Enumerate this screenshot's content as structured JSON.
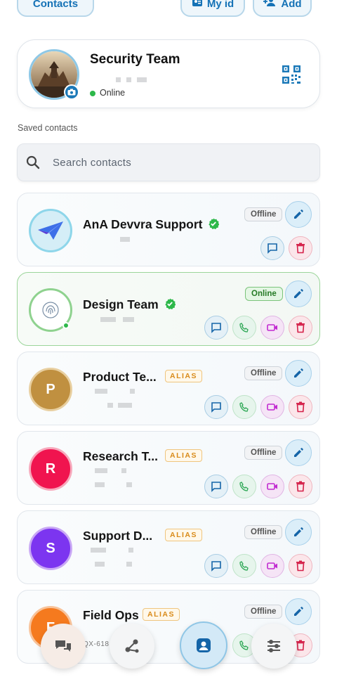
{
  "header": {
    "contacts_label": "Contacts",
    "my_id_label": "My id",
    "add_label": "Add"
  },
  "profile": {
    "name": "Security Team",
    "status": "Online",
    "qr_icon": "qr-code-icon",
    "camera_icon": "camera-icon"
  },
  "saved_label": "Saved contacts",
  "search": {
    "placeholder": "Search contacts"
  },
  "contacts": [
    {
      "name": "AnA Devvra Support",
      "verified": true,
      "status": "Offline",
      "avatar": "paper-plane-logo"
    },
    {
      "name": "Design Team",
      "verified": true,
      "status": "Online",
      "avatar": "fingerprint-logo"
    },
    {
      "name": "Product Te...",
      "alias": "ALIAS",
      "status": "Offline",
      "initial": "P",
      "color": "#c09040"
    },
    {
      "name": "Research T...",
      "alias": "ALIAS",
      "status": "Offline",
      "initial": "R",
      "color": "#f0144f"
    },
    {
      "name": "Support D...",
      "alias": "ALIAS",
      "status": "Offline",
      "initial": "S",
      "color": "#7c35f0"
    },
    {
      "name": "Field Ops",
      "alias": "ALIAS",
      "status": "Offline",
      "initial": "F",
      "color": "#f57a1e",
      "id_fragment": "QX-618"
    }
  ],
  "colors": {
    "accent": "#1b79b8",
    "online": "#2db84a",
    "verified": "#2db84a",
    "alias": "#d98b1a"
  }
}
